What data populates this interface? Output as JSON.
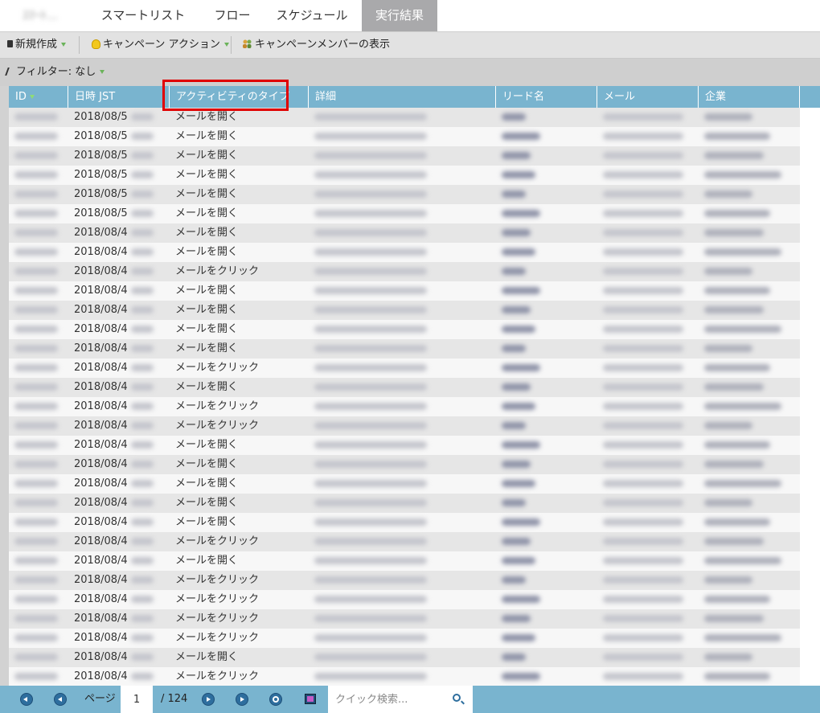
{
  "tabs": [
    {
      "label": "ｽﾏｰﾄ...",
      "blurred": true
    },
    {
      "label": "スマートリスト"
    },
    {
      "label": "フロー"
    },
    {
      "label": "スケジュール"
    },
    {
      "label": "実行結果",
      "active": true
    }
  ],
  "toolbar": {
    "new_label": "新規作成",
    "campaign_action_label": "キャンペーン アクション",
    "show_members_label": "キャンペーンメンバーの表示"
  },
  "filter": {
    "label": "フィルター: なし"
  },
  "columns": [
    "ID",
    "日時 JST",
    "アクティビティのタイプ",
    "詳細",
    "リード名",
    "メール",
    "企業"
  ],
  "rows": [
    {
      "date": "2018/08/5",
      "type": "メールを開く"
    },
    {
      "date": "2018/08/5",
      "type": "メールを開く"
    },
    {
      "date": "2018/08/5",
      "type": "メールを開く"
    },
    {
      "date": "2018/08/5",
      "type": "メールを開く"
    },
    {
      "date": "2018/08/5",
      "type": "メールを開く"
    },
    {
      "date": "2018/08/5",
      "type": "メールを開く"
    },
    {
      "date": "2018/08/4",
      "type": "メールを開く"
    },
    {
      "date": "2018/08/4",
      "type": "メールを開く"
    },
    {
      "date": "2018/08/4",
      "type": "メールをクリック"
    },
    {
      "date": "2018/08/4",
      "type": "メールを開く"
    },
    {
      "date": "2018/08/4",
      "type": "メールを開く"
    },
    {
      "date": "2018/08/4",
      "type": "メールを開く"
    },
    {
      "date": "2018/08/4",
      "type": "メールを開く"
    },
    {
      "date": "2018/08/4",
      "type": "メールをクリック"
    },
    {
      "date": "2018/08/4",
      "type": "メールを開く"
    },
    {
      "date": "2018/08/4",
      "type": "メールをクリック"
    },
    {
      "date": "2018/08/4",
      "type": "メールをクリック"
    },
    {
      "date": "2018/08/4",
      "type": "メールを開く"
    },
    {
      "date": "2018/08/4",
      "type": "メールを開く"
    },
    {
      "date": "2018/08/4",
      "type": "メールを開く"
    },
    {
      "date": "2018/08/4",
      "type": "メールを開く"
    },
    {
      "date": "2018/08/4",
      "type": "メールを開く"
    },
    {
      "date": "2018/08/4",
      "type": "メールをクリック"
    },
    {
      "date": "2018/08/4",
      "type": "メールを開く"
    },
    {
      "date": "2018/08/4",
      "type": "メールをクリック"
    },
    {
      "date": "2018/08/4",
      "type": "メールをクリック"
    },
    {
      "date": "2018/08/4",
      "type": "メールをクリック"
    },
    {
      "date": "2018/08/4",
      "type": "メールをクリック"
    },
    {
      "date": "2018/08/4",
      "type": "メールを開く"
    },
    {
      "date": "2018/08/4",
      "type": "メールをクリック"
    }
  ],
  "footer": {
    "page_label": "ページ",
    "page_value": "1",
    "total_pages": "/ 124",
    "search_placeholder": "クイック検索..."
  },
  "colors": {
    "header_bg": "#79b4cf",
    "highlight": "#e00000",
    "active_tab": "#a9a9ab"
  }
}
